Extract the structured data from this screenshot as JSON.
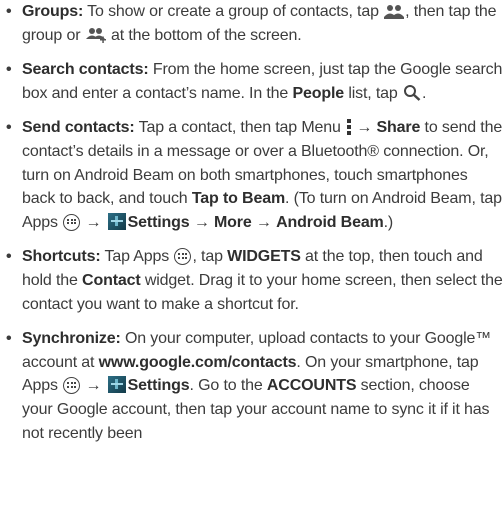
{
  "items": [
    {
      "label": "Groups:",
      "t1": " To show or create a group of contacts, tap ",
      "t2": ", then tap the group or ",
      "t3": " at the bottom of the screen."
    },
    {
      "label": "Search contacts:",
      "t1": " From the home screen, just tap the Google search box and enter a contact’s name. In the ",
      "b1": "People",
      "t2": " list, tap ",
      "t3": "."
    },
    {
      "label": "Send contacts:",
      "t1": " Tap a contact, then tap Menu ",
      "t2": " → ",
      "b1": "Share",
      "t3": " to send the contact’s details in a message or over a Bluetooth® connection. Or, turn on Android Beam on both smartphones, touch smartphones back to back, and touch ",
      "b2": "Tap to Beam",
      "t4": ". (To turn on Android Beam, tap Apps ",
      "t5": " → ",
      "b3": "Settings",
      "t6": " → ",
      "b4": "More",
      "t7": " → ",
      "b5": "Android Beam",
      "t8": ".)"
    },
    {
      "label": "Shortcuts:",
      "t1": " Tap Apps ",
      "t2": ", tap ",
      "b1": "WIDGETS",
      "t3": " at the top, then touch and hold the ",
      "b2": "Contact",
      "t4": " widget. Drag it to your home screen, then select the contact you want to make a shortcut for."
    },
    {
      "label": "Synchronize:",
      "t1": " On your computer, upload contacts to your Google™ account at ",
      "b1": "www.google.com/contacts",
      "t2": ". On your smartphone, tap Apps ",
      "t3": " → ",
      "b2": "Settings",
      "t4": ". Go to the ",
      "b3": "ACCOUNTS",
      "t5": " section, choose your Google account, then tap your account name to sync it if it has not recently been"
    }
  ],
  "bullet_char": "•"
}
